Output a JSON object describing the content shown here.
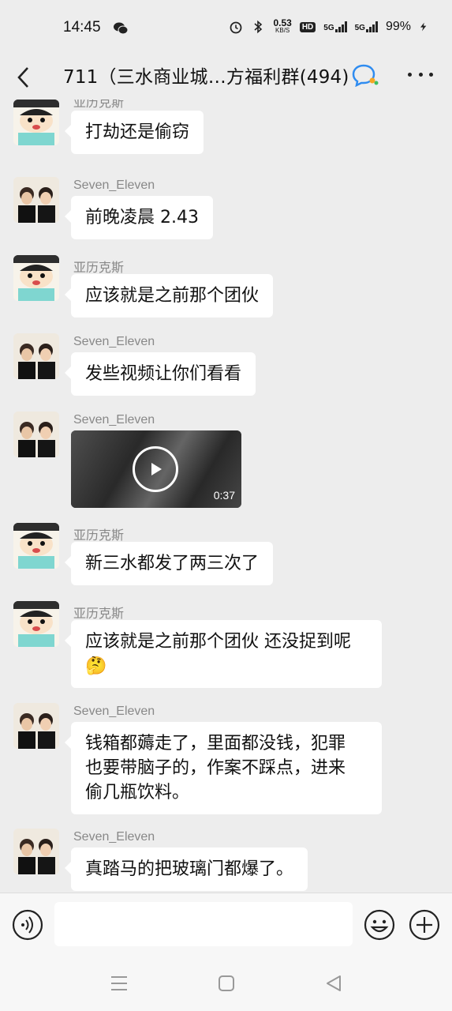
{
  "status": {
    "time": "14:45",
    "speed_value": "0.53",
    "speed_unit": "KB/S",
    "hd_badge": "HD",
    "net1": "5G",
    "net2": "5G",
    "battery": "99%",
    "icons": [
      "wechat-icon",
      "alarm-icon",
      "bluetooth-icon",
      "signal-icon",
      "battery-charging-icon"
    ]
  },
  "header": {
    "title": "711（三水商业城…方福利群(494)",
    "icons": [
      "back-icon",
      "group-chat-icon",
      "more-icon"
    ]
  },
  "messages": [
    {
      "sender": "亚历克斯",
      "text": "打劫还是偷窃",
      "avatar": "crayon-avatar"
    },
    {
      "sender": "Seven_Eleven",
      "text": "前晚凌晨 2.43",
      "avatar": "photo-avatar"
    },
    {
      "sender": "亚历克斯",
      "text": "应该就是之前那个团伙",
      "avatar": "crayon-avatar"
    },
    {
      "sender": "Seven_Eleven",
      "text": "发些视频让你们看看",
      "avatar": "photo-avatar"
    },
    {
      "sender": "Seven_Eleven",
      "video_duration": "0:37",
      "avatar": "photo-avatar"
    },
    {
      "sender": "亚历克斯",
      "text": "新三水都发了两三次了",
      "avatar": "crayon-avatar"
    },
    {
      "sender": "亚历克斯",
      "text": "应该就是之前那个团伙 还没捉到呢",
      "emoji": "🤔",
      "avatar": "crayon-avatar"
    },
    {
      "sender": "Seven_Eleven",
      "text_lines": [
        "钱箱都薅走了，里面都没钱，犯罪",
        "也要带脑子的，作案不踩点，进来",
        "偷几瓶饮料。"
      ],
      "avatar": "photo-avatar"
    },
    {
      "sender": "Seven_Eleven",
      "text": "真踏马的把玻璃门都爆了。",
      "avatar": "photo-avatar"
    }
  ],
  "input": {
    "placeholder": "",
    "icons": [
      "voice-icon",
      "emoji-icon",
      "plus-icon"
    ]
  },
  "system_nav": {
    "icons": [
      "menu-icon",
      "home-icon",
      "back-triangle-icon"
    ]
  }
}
